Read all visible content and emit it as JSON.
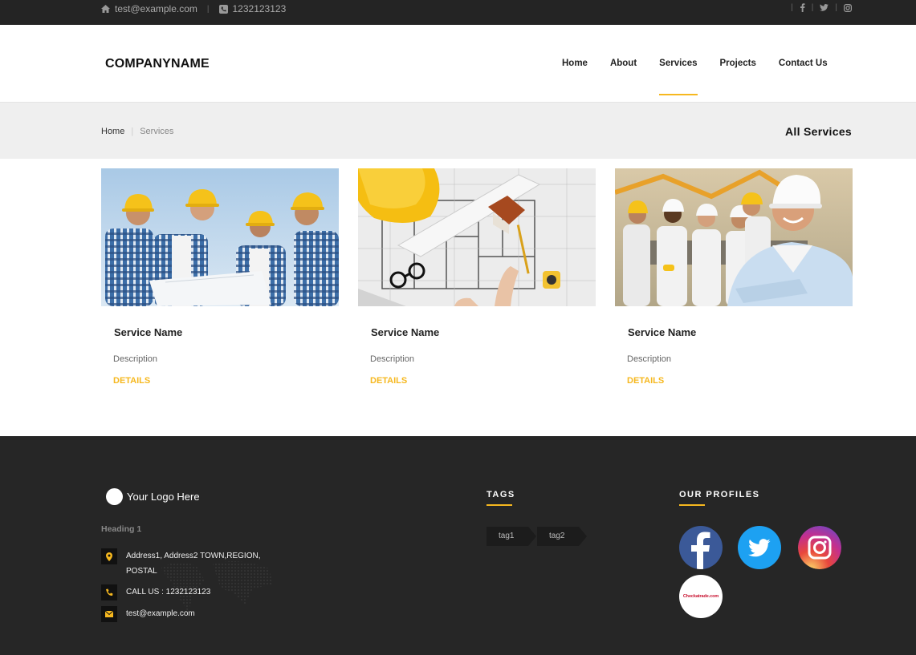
{
  "topbar": {
    "email": "test@example.com",
    "phone": "1232123123",
    "social": [
      "facebook-icon",
      "twitter-icon",
      "instagram-icon"
    ]
  },
  "header": {
    "brand": "COMPANYNAME",
    "nav": [
      {
        "label": "Home",
        "active": false
      },
      {
        "label": "About",
        "active": false
      },
      {
        "label": "Services",
        "active": true
      },
      {
        "label": "Projects",
        "active": false
      },
      {
        "label": "Contact Us",
        "active": false
      }
    ]
  },
  "page_header": {
    "breadcrumb": [
      "Home",
      "Services"
    ],
    "title": "All Services"
  },
  "services": [
    {
      "name": "Service Name",
      "description": "Description",
      "link": "DETAILS",
      "image": "construction-workers-blueprint"
    },
    {
      "name": "Service Name",
      "description": "Description",
      "link": "DETAILS",
      "image": "floor-plan-hardhat"
    },
    {
      "name": "Service Name",
      "description": "Description",
      "link": "DETAILS",
      "image": "engineer-team-site"
    }
  ],
  "footer": {
    "logo_text": "Your Logo Here",
    "heading": "Heading 1",
    "address_line1": "Address1, Address2 TOWN,REGION,",
    "address_line2": "POSTAL",
    "phone": "CALL US : 1232123123",
    "email": "test@example.com",
    "tags_title": "TAGS",
    "tags": [
      "tag1",
      "tag2"
    ],
    "profiles_title": "OUR PROFILES",
    "profiles": [
      "facebook",
      "twitter",
      "instagram",
      "checkatrade"
    ],
    "checkatrade_text": "Checkatrade.com"
  },
  "colors": {
    "accent": "#f6b81f",
    "topbar_bg": "#242424",
    "footer_bg": "#262626",
    "page_header_bg": "#efefef"
  }
}
